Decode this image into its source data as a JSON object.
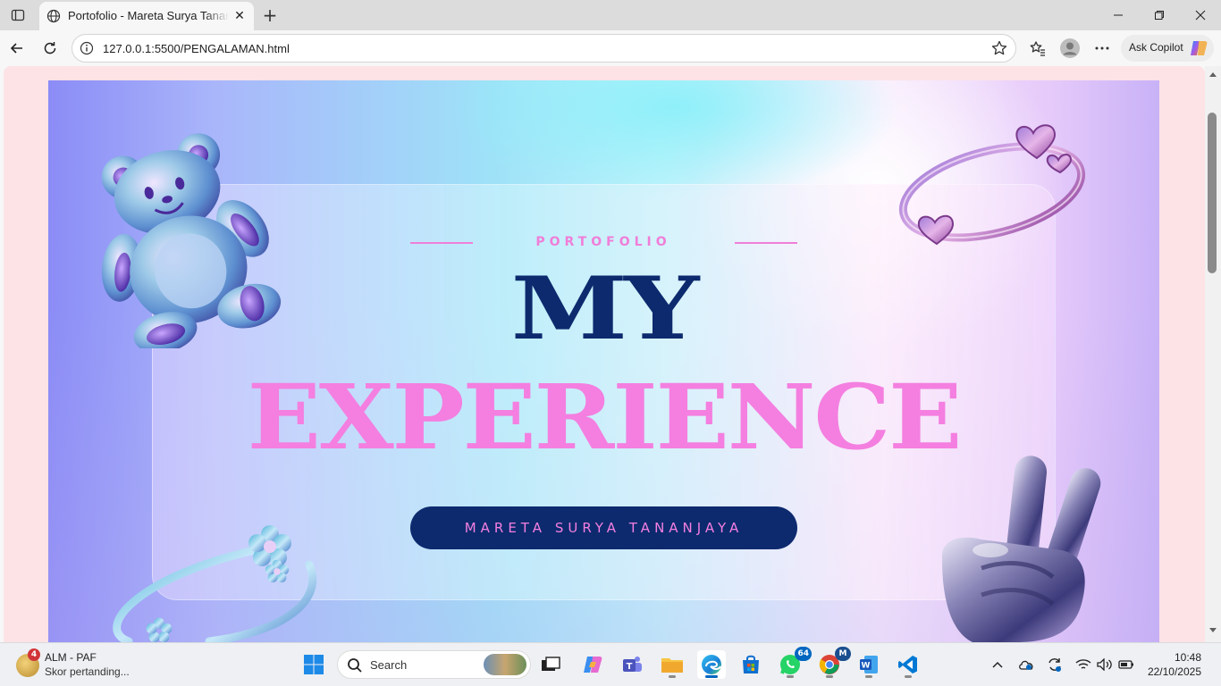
{
  "browser": {
    "tab_title": "Portofolio - Mareta Surya Tananjaya",
    "tab_close": "✕",
    "new_tab": "+",
    "url": "127.0.0.1:5500/PENGALAMAN.html",
    "copilot_label": "Ask Copilot",
    "window_controls": {
      "minimize": "—",
      "maximize": "❐",
      "close": "✕"
    }
  },
  "hero": {
    "eyebrow": "PORTOFOLIO",
    "title_line1": "MY",
    "title_line2": "EXPERIENCE",
    "name_button": "MARETA SURYA TANANJAYA"
  },
  "colors": {
    "navy": "#0d2a6e",
    "pink": "#f47fe0",
    "page_bg": "#fde2e6"
  },
  "decorations": [
    "teddy-bear-icon",
    "heart-ring-icon",
    "flower-ring-icon",
    "peace-hand-icon"
  ],
  "taskbar": {
    "widget_title": "ALM - PAF",
    "widget_subtitle": "Skor pertanding...",
    "widget_badge": "4",
    "search_placeholder": "Search",
    "whatsapp_badge": "64",
    "chrome_badge": "M",
    "time": "10:48",
    "date": "22/10/2025"
  }
}
